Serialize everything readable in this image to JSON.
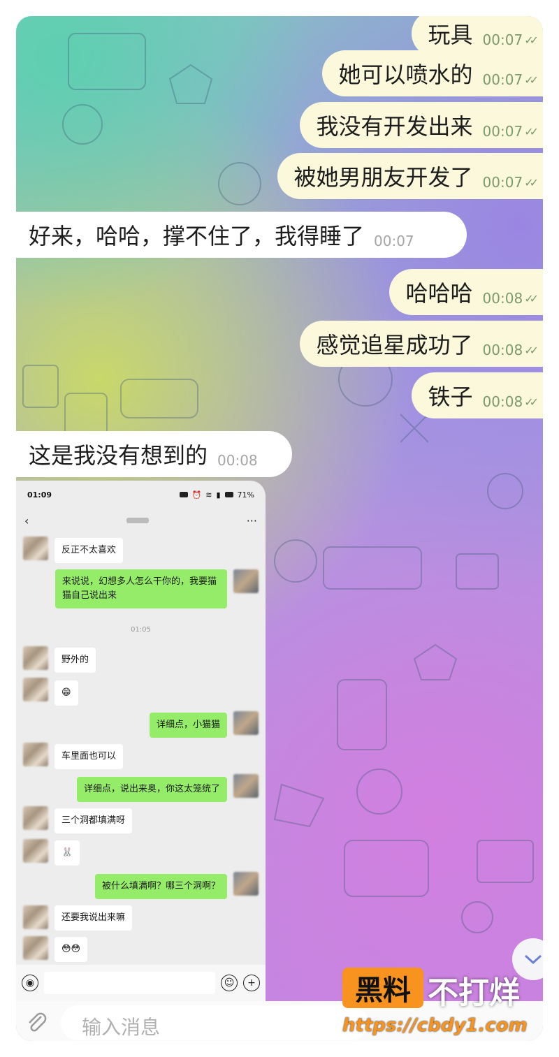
{
  "colors": {
    "outgoing_bubble": "#fbf8dc",
    "incoming_bubble": "#ffffff",
    "wechat_green": "#95ec69",
    "watermark_orange": "#f7931e"
  },
  "messages": [
    {
      "dir": "out",
      "text": "玩具",
      "time": "00:07"
    },
    {
      "dir": "out",
      "text": "她可以喷水的",
      "time": "00:07"
    },
    {
      "dir": "out",
      "text": "我没有开发出来",
      "time": "00:07"
    },
    {
      "dir": "out",
      "text": "被她男朋友开发了",
      "time": "00:07"
    },
    {
      "dir": "in",
      "text": "好来，哈哈，撑不住了，我得睡了",
      "time": "00:07"
    },
    {
      "dir": "out",
      "text": "哈哈哈",
      "time": "00:08"
    },
    {
      "dir": "out",
      "text": "感觉追星成功了",
      "time": "00:08"
    },
    {
      "dir": "out",
      "text": "铁子",
      "time": "00:08"
    },
    {
      "dir": "in",
      "text": "这是我没有想到的",
      "time": "00:08"
    }
  ],
  "ticks": "✓✓",
  "screenshot": {
    "status_time": "01:09",
    "battery": "71%",
    "back_icon": "‹",
    "more_icon": "···",
    "timestamp": "01:05",
    "chat": [
      {
        "side": "left",
        "text": "反正不太喜欢"
      },
      {
        "side": "right",
        "text": "来说说，幻想多人怎么干你的，我要猫猫自己说出来"
      },
      {
        "side": "left",
        "text": "野外的"
      },
      {
        "side": "left",
        "text": "😁"
      },
      {
        "side": "right",
        "text": "详细点，小猫猫"
      },
      {
        "side": "left",
        "text": "车里面也可以"
      },
      {
        "side": "right",
        "text": "详细点，说出来奥，你这太笼统了"
      },
      {
        "side": "left",
        "text": "三个洞都填满呀"
      },
      {
        "side": "left",
        "text": "🐰"
      },
      {
        "side": "right",
        "text": "被什么填满啊？哪三个洞啊？"
      },
      {
        "side": "left",
        "text": "还要我说出来嘛"
      },
      {
        "side": "left",
        "text": "😳😳"
      }
    ],
    "emoji_icon": "☺",
    "plus_icon": "+",
    "voice_icon": "◉"
  },
  "input": {
    "placeholder": "输入消息",
    "attach_icon": "paperclip-icon"
  },
  "scroll_down_icon": "chevron-down",
  "watermark": {
    "left": "黑料",
    "right": "不打烊",
    "url": "https://cbdy1.com"
  }
}
